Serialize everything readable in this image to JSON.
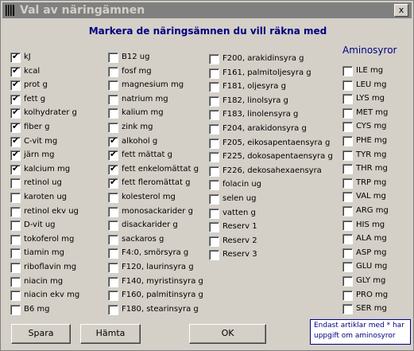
{
  "window": {
    "title": "Val av näringämnen",
    "close_label": "x"
  },
  "heading": "Markera de näringsämnen du vill räkna med",
  "columns": [
    [
      {
        "label": "kJ",
        "checked": true
      },
      {
        "label": "kcal",
        "checked": true
      },
      {
        "label": "prot g",
        "checked": true
      },
      {
        "label": "fett g",
        "checked": true
      },
      {
        "label": "kolhydrater g",
        "checked": true
      },
      {
        "label": "fiber g",
        "checked": true
      },
      {
        "label": "C-vit mg",
        "checked": true
      },
      {
        "label": "järn mg",
        "checked": true
      },
      {
        "label": "kalcium mg",
        "checked": true
      },
      {
        "label": "retinol ug",
        "checked": false
      },
      {
        "label": "karoten ug",
        "checked": false
      },
      {
        "label": "retinol ekv ug",
        "checked": false
      },
      {
        "label": "D-vit ug",
        "checked": false
      },
      {
        "label": "tokoferol mg",
        "checked": false
      },
      {
        "label": "tiamin mg",
        "checked": false
      },
      {
        "label": "riboflavin mg",
        "checked": false
      },
      {
        "label": "niacin mg",
        "checked": false
      },
      {
        "label": "niacin ekv mg",
        "checked": false
      },
      {
        "label": "B6 mg",
        "checked": false
      }
    ],
    [
      {
        "label": "B12 ug",
        "checked": false
      },
      {
        "label": "fosf mg",
        "checked": false
      },
      {
        "label": "magnesium mg",
        "checked": false
      },
      {
        "label": "natrium mg",
        "checked": false
      },
      {
        "label": "kalium mg",
        "checked": false
      },
      {
        "label": "zink mg",
        "checked": false
      },
      {
        "label": "alkohol g",
        "checked": true
      },
      {
        "label": "fett mättat g",
        "checked": true
      },
      {
        "label": "fett enkelomättat g",
        "checked": true
      },
      {
        "label": "fett fleromättat g",
        "checked": true
      },
      {
        "label": "kolesterol mg",
        "checked": false
      },
      {
        "label": "monosackarider g",
        "checked": false
      },
      {
        "label": "disackarider g",
        "checked": false
      },
      {
        "label": "sackaros g",
        "checked": false
      },
      {
        "label": "F4:0, smörsyra g",
        "checked": false
      },
      {
        "label": "F120, laurinsyra g",
        "checked": false
      },
      {
        "label": "F140, myristinsyra g",
        "checked": false
      },
      {
        "label": "F160, palmitinsyra g",
        "checked": false
      },
      {
        "label": "F180, stearinsyra g",
        "checked": false
      }
    ],
    [
      {
        "label": "F200, arakidinsyra g",
        "checked": false
      },
      {
        "label": "F161, palmitoljesyra g",
        "checked": false
      },
      {
        "label": "F181, oljesyra g",
        "checked": false
      },
      {
        "label": "F182, linolsyra g",
        "checked": false
      },
      {
        "label": "F183, linolensyra g",
        "checked": false
      },
      {
        "label": "F204, arakidonsyra g",
        "checked": false
      },
      {
        "label": "F205, eikosapentaensyra g",
        "checked": false
      },
      {
        "label": "F225, dokosapentaensyra g",
        "checked": false
      },
      {
        "label": "F226, dekosahexaensyra",
        "checked": false
      },
      {
        "label": "folacin ug",
        "checked": false
      },
      {
        "label": "selen ug",
        "checked": false
      },
      {
        "label": "vatten g",
        "checked": false
      },
      {
        "label": "Reserv 1",
        "checked": false
      },
      {
        "label": "Reserv 2",
        "checked": false
      },
      {
        "label": "Reserv 3",
        "checked": false
      }
    ],
    [
      {
        "label": "ILE mg",
        "checked": false
      },
      {
        "label": "LEU mg",
        "checked": false
      },
      {
        "label": "LYS mg",
        "checked": false
      },
      {
        "label": "MET mg",
        "checked": false
      },
      {
        "label": "CYS mg",
        "checked": false
      },
      {
        "label": "PHE mg",
        "checked": false
      },
      {
        "label": "TYR mg",
        "checked": false
      },
      {
        "label": "THR mg",
        "checked": false
      },
      {
        "label": "TRP mg",
        "checked": false
      },
      {
        "label": "VAL mg",
        "checked": false
      },
      {
        "label": "ARG mg",
        "checked": false
      },
      {
        "label": "HIS mg",
        "checked": false
      },
      {
        "label": "ALA mg",
        "checked": false
      },
      {
        "label": "ASP mg",
        "checked": false
      },
      {
        "label": "GLU mg",
        "checked": false
      },
      {
        "label": "GLY mg",
        "checked": false
      },
      {
        "label": "PRO mg",
        "checked": false
      },
      {
        "label": "SER mg",
        "checked": false
      }
    ]
  ],
  "amino_heading": "Aminosyror",
  "buttons": {
    "save": "Spara",
    "fetch": "Hämta",
    "ok": "OK"
  },
  "note": "Endast artiklar med * har uppgift om aminosyror",
  "icons": {
    "app": "cutlery-icon",
    "close": "close-icon"
  }
}
